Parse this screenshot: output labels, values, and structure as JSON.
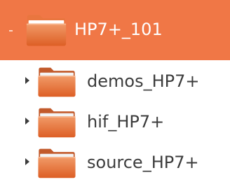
{
  "tree": {
    "root": {
      "label": "HP7+_101",
      "icon": "folder-icon",
      "selected": true,
      "expanded": true
    },
    "children": [
      {
        "label": "demos_HP7+",
        "icon": "folder-icon",
        "expanded": false
      },
      {
        "label": "hif_HP7+",
        "icon": "folder-icon",
        "expanded": false
      },
      {
        "label": "source_HP7+",
        "icon": "folder-icon",
        "expanded": false
      }
    ]
  },
  "colors": {
    "selection": "#f07746",
    "selected_text": "#ffffff",
    "text": "#3c3c3c",
    "folder_front": "#e86f36",
    "folder_back": "#f4a57a"
  }
}
